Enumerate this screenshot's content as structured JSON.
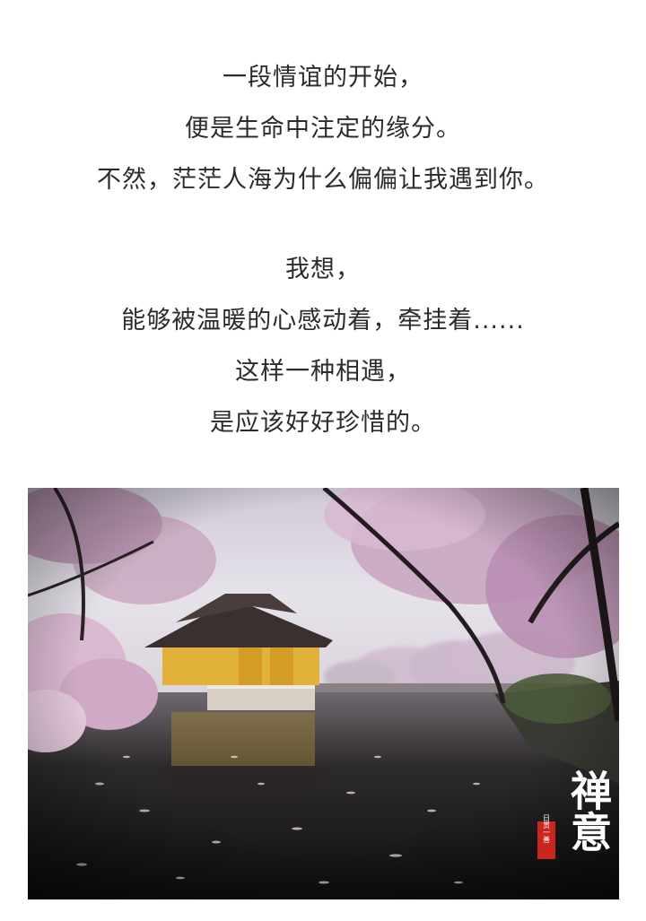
{
  "poem": {
    "stanza1": [
      "一段情谊的开始，",
      "便是生命中注定的缘分。",
      "不然，茫茫人海为什么偏偏让我遇到你。"
    ],
    "stanza2": [
      "我想，",
      "能够被温暖的心感动着，牵挂着......",
      "这样一种相遇，",
      "是应该好好珍惜的。"
    ]
  },
  "photo": {
    "watermark": "禅意",
    "seal": "日贯一善"
  },
  "colors": {
    "text": "#2b2b2b",
    "background": "#ffffff",
    "temple_wall": "#e2b13a",
    "blossom": "#d9b6d0"
  }
}
